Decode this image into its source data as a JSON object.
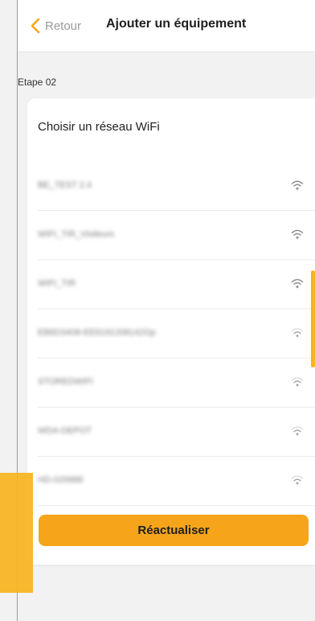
{
  "header": {
    "back_label": "Retour",
    "title": "Ajouter un équipement"
  },
  "step": "Etape 02",
  "card": {
    "title": "Choisir un réseau WiFi",
    "networks": [
      {
        "ssid": "BE_TEST 2.4",
        "signal": "strong"
      },
      {
        "ssid": "WIFI_TIR_Visiteurs",
        "signal": "strong"
      },
      {
        "ssid": "WIFI_TIR",
        "signal": "strong"
      },
      {
        "ssid": "EB6D3408-EE8192J08142Gp",
        "signal": "medium"
      },
      {
        "ssid": "STOREDWIFI",
        "signal": "medium"
      },
      {
        "ssid": "WDA-DEPOT",
        "signal": "medium"
      },
      {
        "ssid": "HD-029988",
        "signal": "medium"
      }
    ],
    "button_label": "Réactualiser"
  },
  "colors": {
    "accent": "#f6a51b",
    "back_chevron": "#f6a51b",
    "muted_text": "#9a9a9a"
  },
  "icons": {
    "back": "chevron-left-icon",
    "network": "wifi-icon"
  }
}
